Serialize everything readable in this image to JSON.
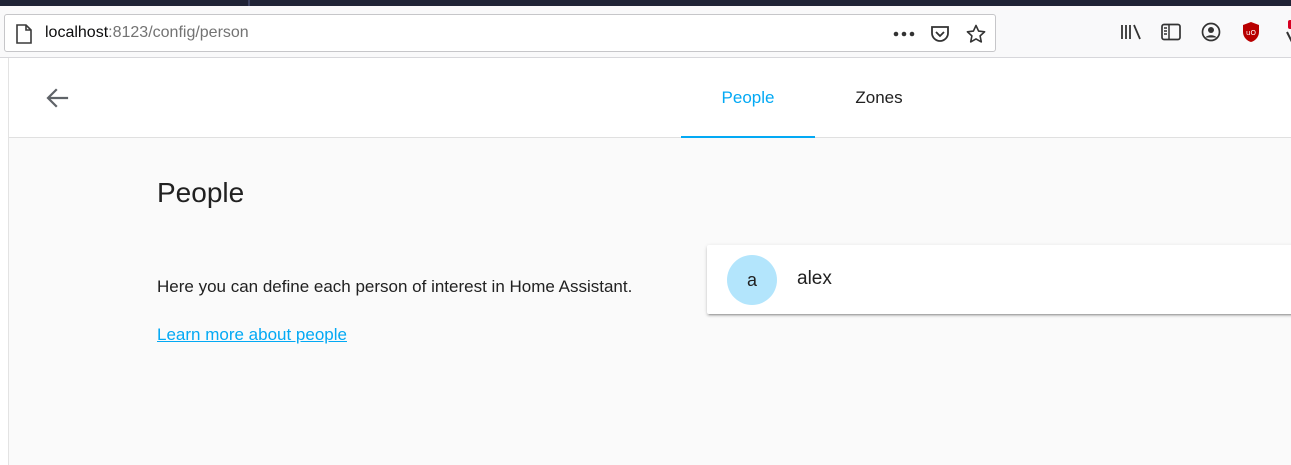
{
  "browser": {
    "url_host": "localhost",
    "url_rest": ":8123/config/person"
  },
  "header": {
    "tabs": [
      {
        "label": "People",
        "active": true
      },
      {
        "label": "Zones",
        "active": false
      }
    ]
  },
  "main": {
    "title": "People",
    "description": "Here you can define each person of interest in Home Assistant.",
    "learn_more_link": "Learn more about people",
    "persons": [
      {
        "initial": "a",
        "name": "alex"
      }
    ]
  },
  "colors": {
    "accent": "#03a9f4",
    "avatar_bg": "#b3e5fc",
    "ublock_red": "#b80000"
  }
}
